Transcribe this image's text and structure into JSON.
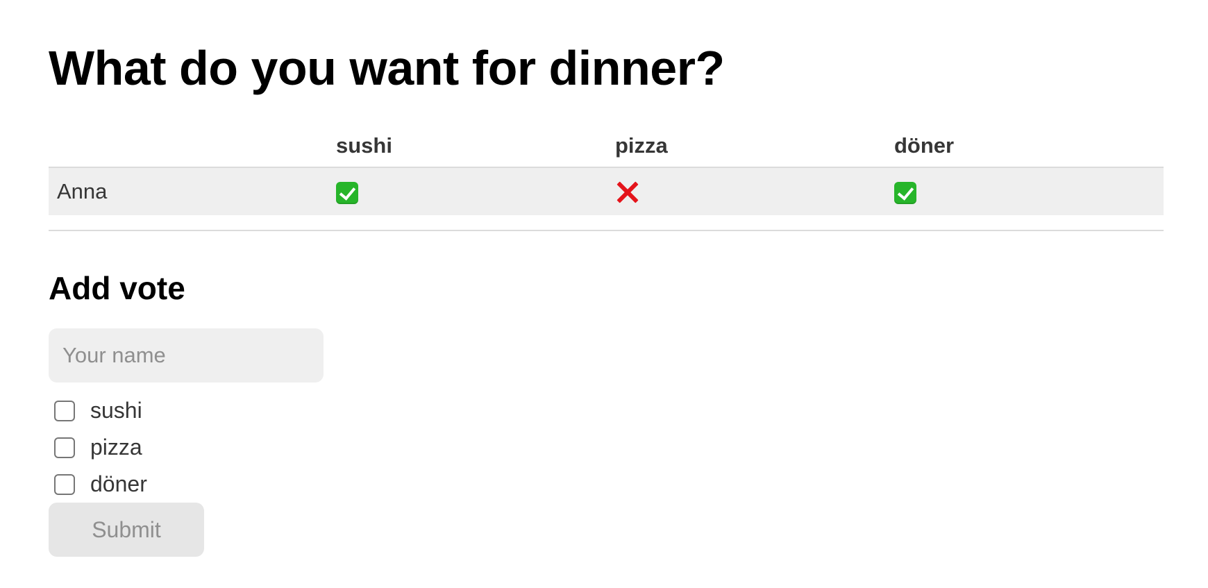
{
  "poll": {
    "title": "What do you want for dinner?",
    "options": [
      "sushi",
      "pizza",
      "döner"
    ]
  },
  "results": {
    "headers": [
      "",
      "sushi",
      "pizza",
      "döner"
    ],
    "rows": [
      {
        "name": "Anna",
        "votes": [
          "check-icon",
          "cross-icon",
          "check-icon"
        ]
      }
    ]
  },
  "add_vote": {
    "heading": "Add vote",
    "name_placeholder": "Your name",
    "options": [
      "sushi",
      "pizza",
      "döner"
    ],
    "submit_label": "Submit"
  }
}
